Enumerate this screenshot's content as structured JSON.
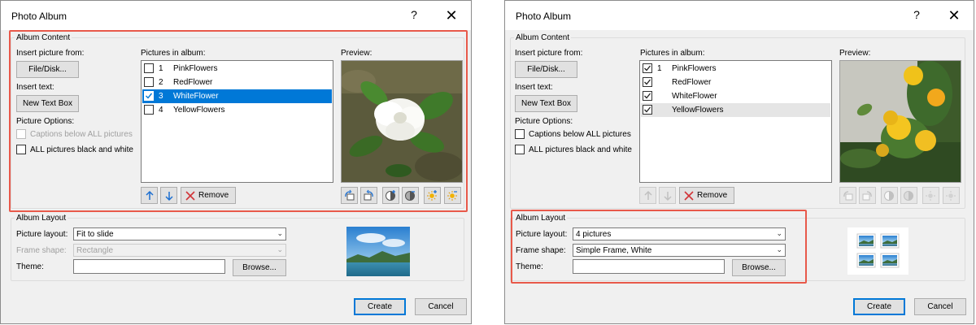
{
  "dialogs": [
    {
      "title": "Photo Album",
      "help_label": "?",
      "close_label": "✕",
      "album_content": {
        "group_label": "Album Content",
        "insert_picture_label": "Insert picture from:",
        "file_disk_button": "File/Disk...",
        "insert_text_label": "Insert text:",
        "new_text_box_button": "New Text Box",
        "picture_options_label": "Picture Options:",
        "captions_label": "Captions below ALL pictures",
        "black_white_label": "ALL pictures black and white",
        "pictures_label": "Pictures in album:",
        "pictures": [
          {
            "num": "1",
            "name": "PinkFlowers",
            "checked": false
          },
          {
            "num": "2",
            "name": "RedFlower",
            "checked": false
          },
          {
            "num": "3",
            "name": "WhiteFlower",
            "checked": true
          },
          {
            "num": "4",
            "name": "YellowFlowers",
            "checked": false
          }
        ],
        "preview_label": "Preview:",
        "remove_button": "Remove"
      },
      "album_layout": {
        "group_label": "Album Layout",
        "picture_layout_label": "Picture layout:",
        "picture_layout_value": "Fit to slide",
        "frame_shape_label": "Frame shape:",
        "frame_shape_value": "Rectangle",
        "theme_label": "Theme:",
        "browse_button": "Browse..."
      },
      "create_button": "Create",
      "cancel_button": "Cancel"
    },
    {
      "title": "Photo Album",
      "help_label": "?",
      "close_label": "✕",
      "album_content": {
        "group_label": "Album Content",
        "insert_picture_label": "Insert picture from:",
        "file_disk_button": "File/Disk...",
        "insert_text_label": "Insert text:",
        "new_text_box_button": "New Text Box",
        "picture_options_label": "Picture Options:",
        "captions_label": "Captions below ALL pictures",
        "black_white_label": "ALL pictures black and white",
        "pictures_label": "Pictures in album:",
        "pictures": [
          {
            "num": "1",
            "name": "PinkFlowers",
            "checked": true
          },
          {
            "num": "",
            "name": "RedFlower",
            "checked": true
          },
          {
            "num": "",
            "name": "WhiteFlower",
            "checked": true
          },
          {
            "num": "",
            "name": "YellowFlowers",
            "checked": true
          }
        ],
        "preview_label": "Preview:",
        "remove_button": "Remove"
      },
      "album_layout": {
        "group_label": "Album Layout",
        "picture_layout_label": "Picture layout:",
        "picture_layout_value": "4 pictures",
        "frame_shape_label": "Frame shape:",
        "frame_shape_value": "Simple Frame, White",
        "theme_label": "Theme:",
        "browse_button": "Browse..."
      },
      "create_button": "Create",
      "cancel_button": "Cancel"
    }
  ],
  "colors": {
    "dialog_bg": "#f0f0f0",
    "selection": "#0078d7",
    "highlight_box": "#e8594a",
    "icon_blue": "#1c6fd1",
    "icon_red": "#d13438"
  },
  "icons": [
    "move-up-arrow-icon",
    "move-down-arrow-icon",
    "remove-x-icon",
    "rotate-left-icon",
    "rotate-right-icon",
    "contrast-increase-icon",
    "contrast-decrease-icon",
    "brightness-increase-icon",
    "brightness-decrease-icon"
  ]
}
